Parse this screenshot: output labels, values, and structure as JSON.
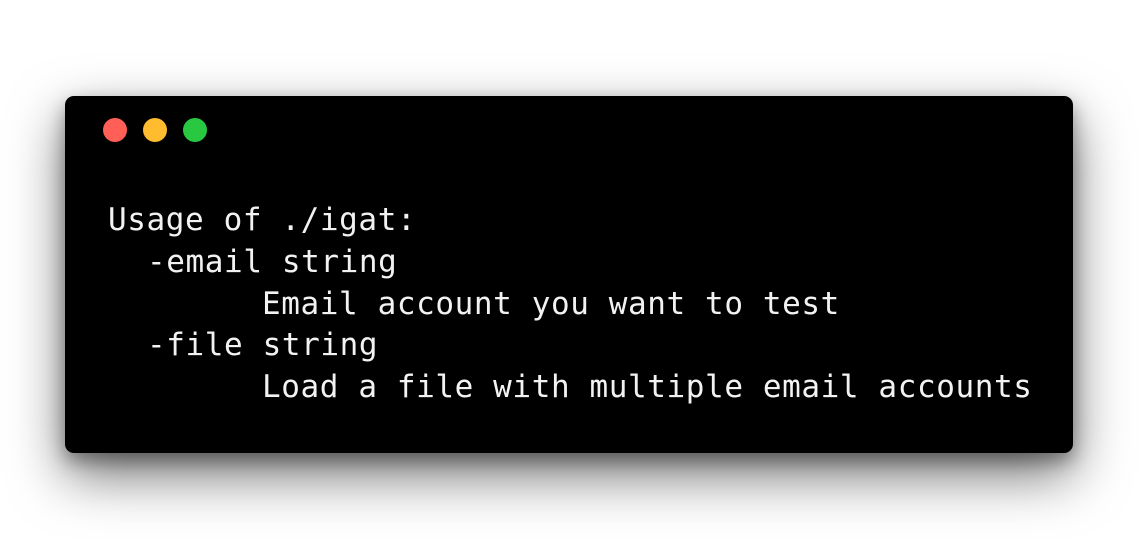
{
  "window": {
    "controls": [
      {
        "name": "close",
        "color": "#ff5f57"
      },
      {
        "name": "minimize",
        "color": "#febc2e"
      },
      {
        "name": "maximize",
        "color": "#28c840"
      }
    ],
    "background": "#000000"
  },
  "terminal": {
    "lines": [
      "Usage of ./igat:",
      "-email string",
      "Email account you want to test",
      "-file string",
      "Load a file with multiple email accounts"
    ],
    "text_color": "#f2f2f2"
  }
}
